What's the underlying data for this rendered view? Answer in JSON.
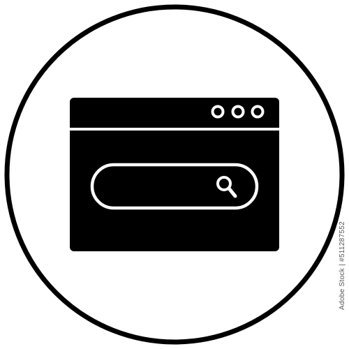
{
  "icon": {
    "name": "browser-search-icon",
    "colors": {
      "fill": "#000000",
      "background": "#ffffff"
    }
  },
  "side_text": "Adobe Stock | #511287552"
}
